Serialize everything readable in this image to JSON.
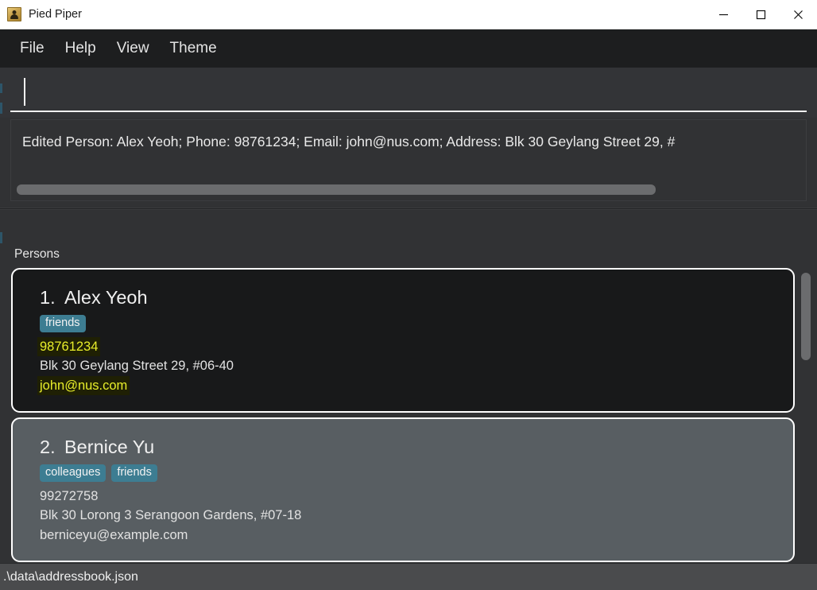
{
  "window": {
    "title": "Pied Piper",
    "icon": "person-card-icon",
    "minimize_label": "minimize-icon",
    "maximize_label": "maximize-icon",
    "close_label": "close-icon"
  },
  "menubar": {
    "items": [
      {
        "label": "File"
      },
      {
        "label": "Help"
      },
      {
        "label": "View"
      },
      {
        "label": "Theme"
      }
    ]
  },
  "command": {
    "value": "",
    "placeholder": ""
  },
  "result": {
    "text": "Edited Person: Alex Yeoh; Phone: 98761234; Email: john@nus.com; Address: Blk 30 Geylang Street 29, #"
  },
  "list": {
    "header": "Persons",
    "cards": [
      {
        "index": "1.",
        "name": "Alex Yeoh",
        "state": "normal",
        "tags": [
          "friends"
        ],
        "phone": "98761234",
        "phone_highlighted": true,
        "address": "Blk 30 Geylang Street 29, #06-40",
        "email": "john@nus.com",
        "email_highlighted": true
      },
      {
        "index": "2.",
        "name": "Bernice Yu",
        "state": "selected",
        "tags": [
          "colleagues",
          "friends"
        ],
        "phone": "99272758",
        "phone_highlighted": false,
        "address": "Blk 30 Lorong 3 Serangoon Gardens, #07-18",
        "email": "berniceyu@example.com",
        "email_highlighted": false
      }
    ]
  },
  "statusbar": {
    "path": ".\\data\\addressbook.json"
  },
  "colors": {
    "tag_background": "#3d7d92",
    "highlight_text": "#e8ee2a",
    "highlight_background": "#1f2004",
    "card_border": "#ffffff",
    "card_normal_background": "#18191a",
    "card_selected_background": "#585e62",
    "window_background": "#313234",
    "menubar_background": "#1d1e1f",
    "statusbar_background": "#4a4b4d",
    "scrollbar_thumb": "#6b6c6e"
  }
}
